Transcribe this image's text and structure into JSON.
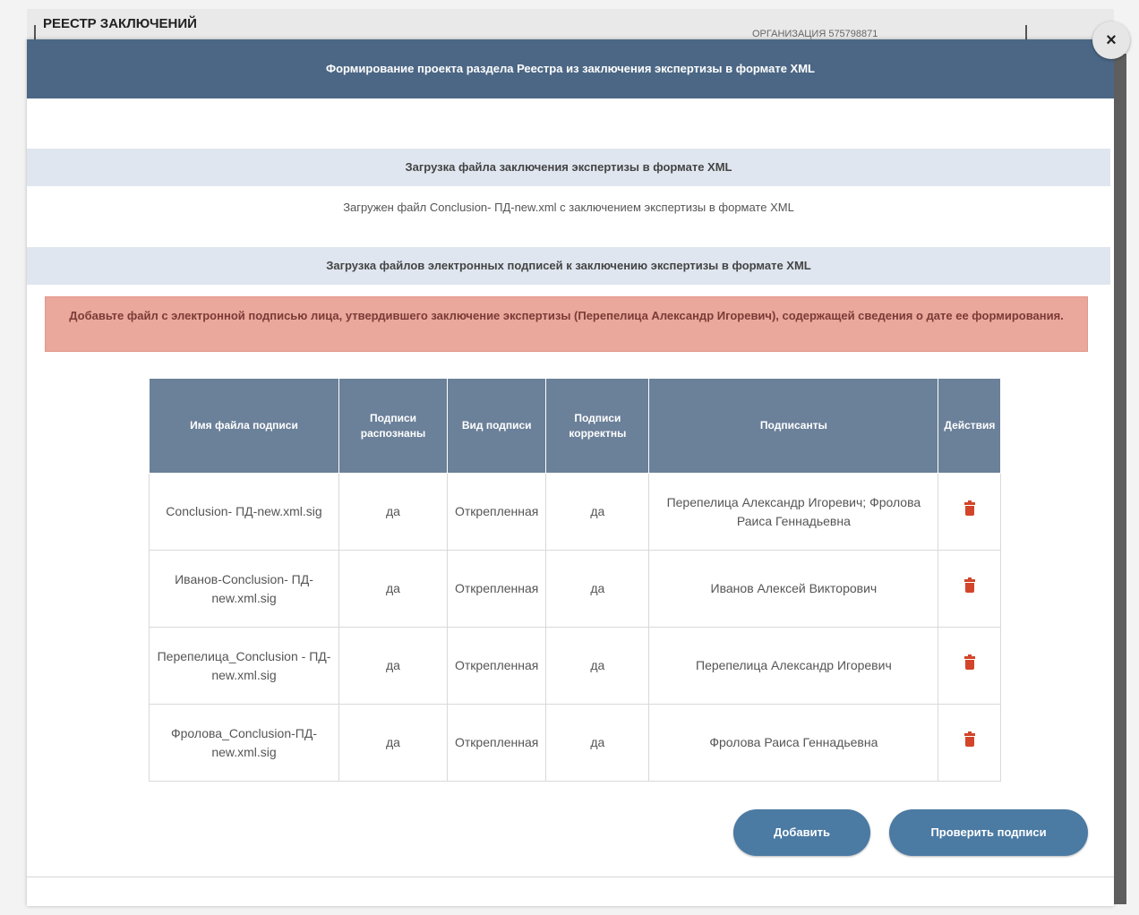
{
  "background": {
    "page_title": "РЕЕСТР ЗАКЛЮЧЕНИЙ",
    "organization": "ОРГАНИЗАЦИЯ 575798871"
  },
  "modal": {
    "title": "Формирование проекта раздела Реестра из заключения экспертизы в формате XML",
    "close_label": "×",
    "section1_title": "Загрузка файла заключения экспертизы в формате XML",
    "uploaded_text": "Загружен файл Conclusion- ПД-new.xml с заключением экспертизы в формате XML",
    "section2_title": "Загрузка файлов электронных подписей к заключению экспертизы в формате XML",
    "alert_text": "Добавьте файл с электронной подписью лица, утвердившего заключение экспертизы (Перепелица Александр Игоревич), содержащей сведения о дате ее формирования."
  },
  "table": {
    "headers": {
      "file": "Имя файла подписи",
      "recognized": "Подписи распознаны",
      "type": "Вид подписи",
      "correct": "Подписи корректны",
      "signers": "Подписанты",
      "actions": "Действия"
    },
    "rows": [
      {
        "file": "Conclusion- ПД-new.xml.sig",
        "recognized": "да",
        "type": "Открепленная",
        "correct": "да",
        "signers": "Перепелица Александр Игоревич; Фролова Раиса Геннадьевна"
      },
      {
        "file": "Иванов-Conclusion- ПД-new.xml.sig",
        "recognized": "да",
        "type": "Открепленная",
        "correct": "да",
        "signers": "Иванов Алексей Викторович"
      },
      {
        "file": "Перепелица_Conclusion - ПД-new.xml.sig",
        "recognized": "да",
        "type": "Открепленная",
        "correct": "да",
        "signers": "Перепелица Александр Игоревич"
      },
      {
        "file": "Фролова_Conclusion-ПД-new.xml.sig",
        "recognized": "да",
        "type": "Открепленная",
        "correct": "да",
        "signers": "Фролова Раиса Геннадьевна"
      }
    ]
  },
  "buttons": {
    "add": "Добавить",
    "verify": "Проверить подписи"
  },
  "colors": {
    "header": "#4b6785",
    "section": "#dfe6ef",
    "alert": "#eaa79c",
    "table_header": "#6b8099",
    "button": "#4b7aa3",
    "trash": "#d2452a"
  }
}
